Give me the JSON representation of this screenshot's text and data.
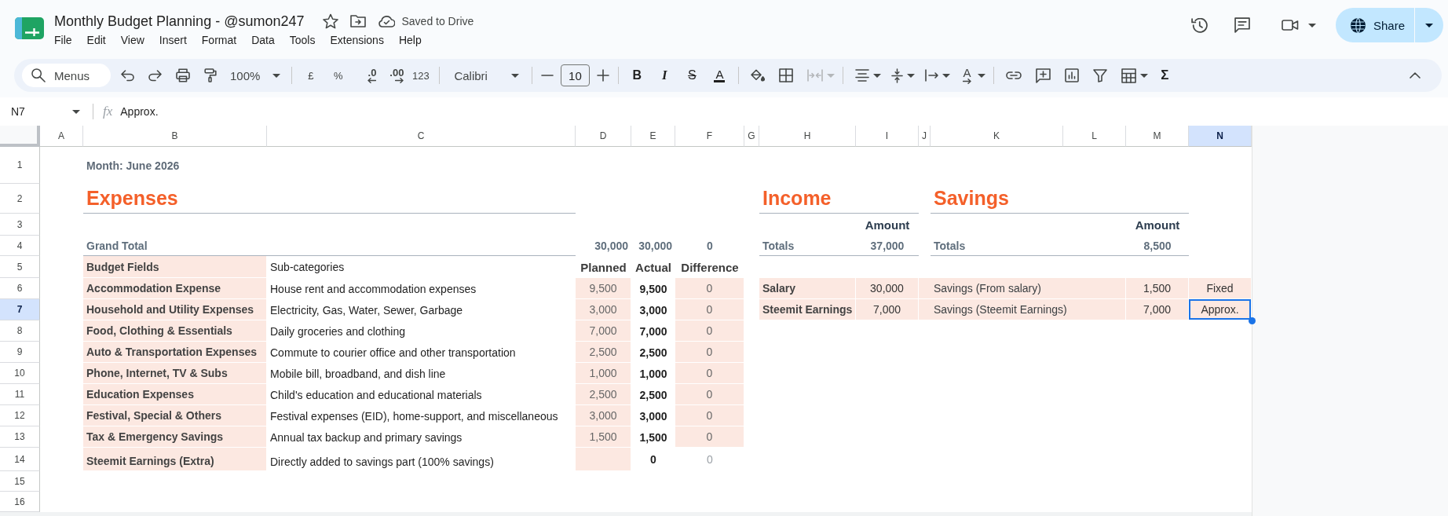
{
  "app_bar": {
    "title": "Monthly Budget Planning - @sumon247",
    "save_status": "Saved to Drive",
    "menu": [
      "File",
      "Edit",
      "View",
      "Insert",
      "Format",
      "Data",
      "Tools",
      "Extensions",
      "Help"
    ],
    "share": "Share"
  },
  "toolbar": {
    "search": {
      "placeholder": "Menus"
    },
    "zoom": "100%",
    "number_formats": [
      {
        "kind": "plain",
        "label": "£"
      },
      {
        "kind": "plain",
        "label": "%"
      },
      {
        "kind": "decrease",
        "label": ".0"
      },
      {
        "kind": "increase",
        "label": ".00"
      },
      {
        "kind": "plain",
        "label": "123"
      }
    ],
    "font": "Calibri",
    "font_size": "10",
    "text_styles": [
      {
        "kind": "bold",
        "label": "B"
      },
      {
        "kind": "italic",
        "label": "I"
      },
      {
        "kind": "strikethrough",
        "label": "S"
      },
      {
        "kind": "text_color",
        "label": "A"
      }
    ],
    "merge_cells": {
      "disabled": true
    },
    "text_rotation": "A",
    "functions": "Σ"
  },
  "formula_bar": {
    "cell": "N7",
    "fx": "fx",
    "formula": "Approx."
  },
  "sheet": {
    "columns": [
      {
        "label": "A",
        "selected": false
      },
      {
        "label": "B",
        "selected": false
      },
      {
        "label": "C",
        "selected": false
      },
      {
        "label": "D",
        "selected": false
      },
      {
        "label": "E",
        "selected": false
      },
      {
        "label": "F",
        "selected": false
      },
      {
        "label": "G",
        "selected": false
      },
      {
        "label": "H",
        "selected": false
      },
      {
        "label": "I",
        "selected": false
      },
      {
        "label": "J",
        "selected": false
      },
      {
        "label": "K",
        "selected": false
      },
      {
        "label": "L",
        "selected": false
      },
      {
        "label": "M",
        "selected": false
      },
      {
        "label": "N",
        "selected": true
      }
    ],
    "rows": [
      {
        "label": "1",
        "selected": false
      },
      {
        "label": "2",
        "selected": false
      },
      {
        "label": "3",
        "selected": false
      },
      {
        "label": "4",
        "selected": false
      },
      {
        "label": "5",
        "selected": false
      },
      {
        "label": "6",
        "selected": false
      },
      {
        "label": "7",
        "selected": true
      },
      {
        "label": "8",
        "selected": false
      },
      {
        "label": "9",
        "selected": false
      },
      {
        "label": "10",
        "selected": false
      },
      {
        "label": "11",
        "selected": false
      },
      {
        "label": "12",
        "selected": false
      },
      {
        "label": "13",
        "selected": false
      },
      {
        "label": "14",
        "selected": false
      },
      {
        "label": "15",
        "selected": false
      },
      {
        "label": "16",
        "selected": false
      }
    ],
    "month": "Month: June 2026",
    "expenses": {
      "title": "Expenses",
      "grand_total": {
        "label": "Grand Total",
        "planned": "30,000",
        "actual": "30,000",
        "difference": "0"
      },
      "header": {
        "field": "Budget Fields",
        "subcategory": "Sub-categories",
        "planned": "Planned",
        "actual": "Actual",
        "difference": "Difference"
      },
      "rows": [
        {
          "kind": "budget",
          "field": "Accommodation Expense",
          "subcategory": "House rent and accommodation expenses",
          "planned": "9,500",
          "actual": "9,500",
          "difference": "0"
        },
        {
          "kind": "budget",
          "field": "Household and Utility Expenses",
          "subcategory": "Electricity, Gas, Water, Sewer, Garbage",
          "planned": "3,000",
          "actual": "3,000",
          "difference": "0"
        },
        {
          "kind": "budget",
          "field": "Food, Clothing & Essentials",
          "subcategory": "Daily groceries and clothing",
          "planned": "7,000",
          "actual": "7,000",
          "difference": "0"
        },
        {
          "kind": "budget",
          "field": "Auto & Transportation Expenses",
          "subcategory": "Commute to courier office and other transportation",
          "planned": "2,500",
          "actual": "2,500",
          "difference": "0"
        },
        {
          "kind": "budget",
          "field": "Phone, Internet, TV & Subs",
          "subcategory": "Mobile bill, broadband, and dish line",
          "planned": "1,000",
          "actual": "1,000",
          "difference": "0"
        },
        {
          "kind": "budget",
          "field": "Education Expenses",
          "subcategory": "Child's education and educational materials",
          "planned": "2,500",
          "actual": "2,500",
          "difference": "0"
        },
        {
          "kind": "budget",
          "field": "Festival, Special & Others",
          "subcategory": "Festival expenses (EID), home-support, and miscellaneous",
          "planned": "3,000",
          "actual": "3,000",
          "difference": "0"
        },
        {
          "kind": "budget",
          "field": "Tax & Emergency Savings",
          "subcategory": "Annual tax backup and primary savings",
          "planned": "1,500",
          "actual": "1,500",
          "difference": "0"
        },
        {
          "kind": "extra",
          "field": "Steemit Earnings (Extra)",
          "subcategory": "Directly added to savings part (100% savings)",
          "actual": "0",
          "difference": "0"
        }
      ]
    },
    "income": {
      "title": "Income",
      "amount_header": "Amount",
      "totals": {
        "label": "Totals",
        "amount": "37,000"
      },
      "rows": [
        {
          "source": "Salary",
          "amount": "30,000"
        },
        {
          "source": "Steemit Earnings",
          "amount": "7,000"
        }
      ]
    },
    "savings": {
      "title": "Savings",
      "amount_header": "Amount",
      "totals": {
        "label": "Totals",
        "amount": "8,500"
      },
      "rows": [
        {
          "item": "Savings (From salary)",
          "amount": "1,500",
          "note": {
            "text": "Fixed",
            "selected": false
          }
        },
        {
          "item": "Savings (Steemit Earnings)",
          "amount": "7,000",
          "note": {
            "text": "Approx.",
            "selected": true
          }
        }
      ]
    }
  }
}
